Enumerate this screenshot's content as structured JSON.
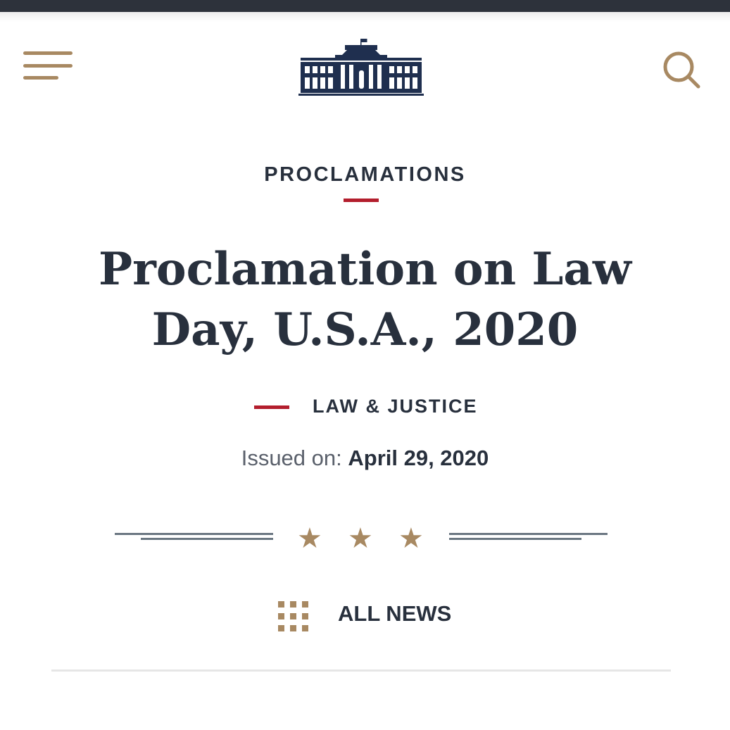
{
  "header": {
    "menu_icon": "hamburger-menu-icon",
    "logo": "white-house-logo",
    "search_icon": "search-icon"
  },
  "article": {
    "section": "PROCLAMATIONS",
    "title": "Proclamation on Law Day, U.S.A., 2020",
    "category": "LAW & JUSTICE",
    "issued_label": "Issued on:",
    "issued_date": "April 29, 2020"
  },
  "ornament": {
    "stars": [
      "★",
      "★",
      "★"
    ]
  },
  "nav": {
    "all_news_label": "ALL NEWS",
    "all_news_icon": "grid-icon"
  },
  "colors": {
    "navy": "#28303d",
    "gold": "#a88962",
    "red": "#b31e2d",
    "topbar": "#2d323b"
  }
}
